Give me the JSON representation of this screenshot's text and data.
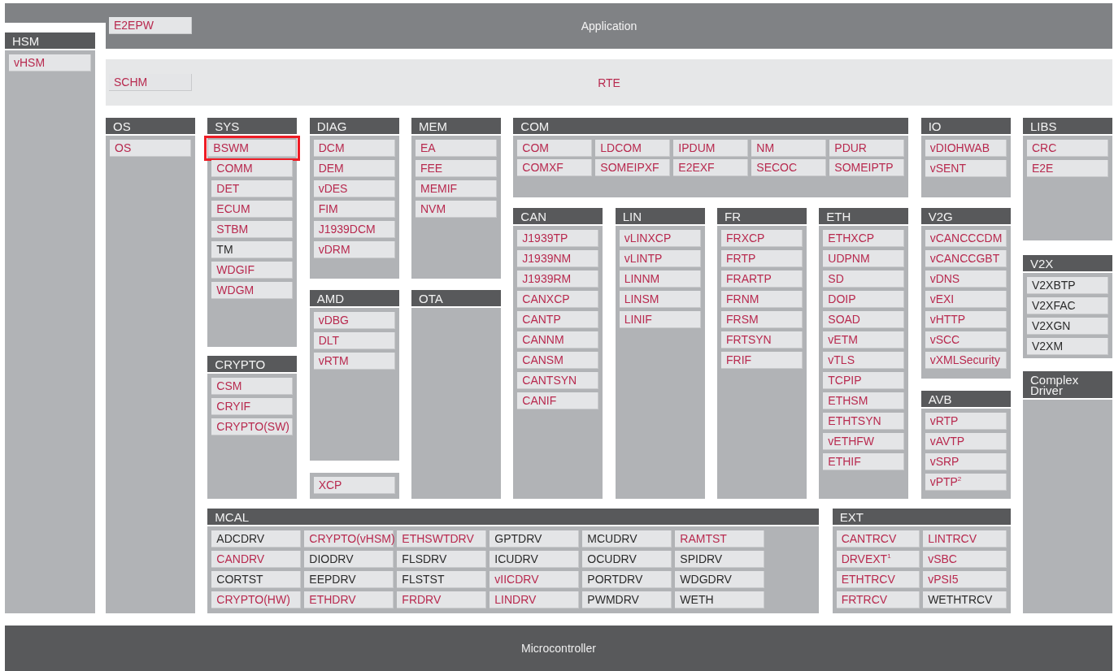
{
  "application": {
    "title": "Application",
    "items": [
      {
        "label": "E2EPW",
        "color": "#b82a4f"
      }
    ]
  },
  "rte": {
    "title": "RTE",
    "items": [
      {
        "label": "SCHM",
        "color": "#b82a4f"
      }
    ]
  },
  "hsm": {
    "title": "HSM",
    "items": [
      {
        "label": "vHSM",
        "color": "#b82a4f"
      }
    ]
  },
  "groups": [
    {
      "title": "OS",
      "items": [
        {
          "label": "OS",
          "color": "#b82a4f"
        }
      ]
    },
    {
      "title": "SYS",
      "items": [
        {
          "label": "BSWM",
          "color": "#b82a4f",
          "highlighted": true
        },
        {
          "label": "COMM",
          "color": "#b82a4f",
          "highlighted": false
        },
        {
          "label": "DET",
          "color": "#b82a4f",
          "highlighted": false
        },
        {
          "label": "ECUM",
          "color": "#b82a4f",
          "highlighted": false
        },
        {
          "label": "STBM",
          "color": "#b82a4f",
          "highlighted": false
        },
        {
          "label": "TM",
          "color": "#2b2b2b",
          "highlighted": false
        },
        {
          "label": "WDGIF",
          "color": "#b82a4f",
          "highlighted": false
        },
        {
          "label": "WDGM",
          "color": "#b82a4f",
          "highlighted": false
        }
      ]
    },
    {
      "title": "CRYPTO",
      "items": [
        {
          "label": "CSM",
          "color": "#b82a4f"
        },
        {
          "label": "CRYIF",
          "color": "#b82a4f"
        },
        {
          "label": "CRYPTO(SW)",
          "color": "#b82a4f"
        }
      ]
    },
    {
      "title": "DIAG",
      "items": [
        {
          "label": "DCM",
          "color": "#b82a4f"
        },
        {
          "label": "DEM",
          "color": "#b82a4f"
        },
        {
          "label": "vDES",
          "color": "#b82a4f"
        },
        {
          "label": "FIM",
          "color": "#b82a4f"
        },
        {
          "label": "J1939DCM",
          "color": "#b82a4f"
        },
        {
          "label": "vDRM",
          "color": "#b82a4f"
        }
      ]
    },
    {
      "title": "AMD",
      "items": [
        {
          "label": "vDBG",
          "color": "#b82a4f"
        },
        {
          "label": "DLT",
          "color": "#b82a4f"
        },
        {
          "label": "vRTM",
          "color": "#b82a4f"
        }
      ]
    },
    {
      "items": [
        {
          "label": "XCP",
          "color": "#b82a4f"
        }
      ]
    },
    {
      "title": "MEM",
      "items": [
        {
          "label": "EA",
          "color": "#b82a4f"
        },
        {
          "label": "FEE",
          "color": "#b82a4f"
        },
        {
          "label": "MEMIF",
          "color": "#b82a4f"
        },
        {
          "label": "NVM",
          "color": "#b82a4f"
        }
      ]
    },
    {
      "title": "OTA"
    },
    {
      "title": "COM",
      "items": [
        {
          "label": "COM",
          "color": "#b82a4f"
        },
        {
          "label": "LDCOM",
          "color": "#b82a4f"
        },
        {
          "label": "IPDUM",
          "color": "#b82a4f"
        },
        {
          "label": "NM",
          "color": "#b82a4f"
        },
        {
          "label": "PDUR",
          "color": "#b82a4f"
        },
        {
          "label": "COMXF",
          "color": "#b82a4f"
        },
        {
          "label": "SOMEIPXF",
          "color": "#b82a4f"
        },
        {
          "label": "E2EXF",
          "color": "#b82a4f"
        },
        {
          "label": "SECOC",
          "color": "#b82a4f"
        },
        {
          "label": "SOMEIPTP",
          "color": "#b82a4f"
        }
      ]
    },
    {
      "title": "CAN",
      "items": [
        {
          "label": "J1939TP",
          "color": "#b82a4f"
        },
        {
          "label": "J1939NM",
          "color": "#b82a4f"
        },
        {
          "label": "J1939RM",
          "color": "#b82a4f"
        },
        {
          "label": "CANXCP",
          "color": "#b82a4f"
        },
        {
          "label": "CANTP",
          "color": "#b82a4f"
        },
        {
          "label": "CANNM",
          "color": "#b82a4f"
        },
        {
          "label": "CANSM",
          "color": "#b82a4f"
        },
        {
          "label": "CANTSYN",
          "color": "#b82a4f"
        },
        {
          "label": "CANIF",
          "color": "#b82a4f"
        }
      ]
    },
    {
      "title": "LIN",
      "items": [
        {
          "label": "vLINXCP",
          "color": "#b82a4f"
        },
        {
          "label": "vLINTP",
          "color": "#b82a4f"
        },
        {
          "label": "LINNM",
          "color": "#b82a4f"
        },
        {
          "label": "LINSM",
          "color": "#b82a4f"
        },
        {
          "label": "LINIF",
          "color": "#b82a4f"
        }
      ]
    },
    {
      "title": "FR",
      "items": [
        {
          "label": "FRXCP",
          "color": "#b82a4f"
        },
        {
          "label": "FRTP",
          "color": "#b82a4f"
        },
        {
          "label": "FRARTP",
          "color": "#b82a4f"
        },
        {
          "label": "FRNM",
          "color": "#b82a4f"
        },
        {
          "label": "FRSM",
          "color": "#b82a4f"
        },
        {
          "label": "FRTSYN",
          "color": "#b82a4f"
        },
        {
          "label": "FRIF",
          "color": "#b82a4f"
        }
      ]
    },
    {
      "title": "ETH",
      "items": [
        {
          "label": "ETHXCP",
          "color": "#b82a4f"
        },
        {
          "label": "UDPNM",
          "color": "#b82a4f"
        },
        {
          "label": "SD",
          "color": "#b82a4f"
        },
        {
          "label": "DOIP",
          "color": "#b82a4f"
        },
        {
          "label": "SOAD",
          "color": "#b82a4f"
        },
        {
          "label": "vETM",
          "color": "#b82a4f"
        },
        {
          "label": "vTLS",
          "color": "#b82a4f"
        },
        {
          "label": "TCPIP",
          "color": "#b82a4f"
        },
        {
          "label": "ETHSM",
          "color": "#b82a4f"
        },
        {
          "label": "ETHTSYN",
          "color": "#b82a4f"
        },
        {
          "label": "vETHFW",
          "color": "#b82a4f"
        },
        {
          "label": "ETHIF",
          "color": "#b82a4f"
        }
      ]
    },
    {
      "title": "IO",
      "items": [
        {
          "label": "vDIOHWAB",
          "color": "#b82a4f"
        },
        {
          "label": "vSENT",
          "color": "#b82a4f"
        }
      ]
    },
    {
      "title": "V2G",
      "items": [
        {
          "label": "vCANCCCDM",
          "color": "#b82a4f"
        },
        {
          "label": "vCANCCGBT",
          "color": "#b82a4f"
        },
        {
          "label": "vDNS",
          "color": "#b82a4f"
        },
        {
          "label": "vEXI",
          "color": "#b82a4f"
        },
        {
          "label": "vHTTP",
          "color": "#b82a4f"
        },
        {
          "label": "vSCC",
          "color": "#b82a4f"
        },
        {
          "label": "vXMLSecurity",
          "color": "#b82a4f"
        }
      ]
    },
    {
      "title": "AVB",
      "items": [
        {
          "label": "vRTP",
          "color": "#b82a4f"
        },
        {
          "label": "vAVTP",
          "color": "#b82a4f"
        },
        {
          "label": "vSRP",
          "color": "#b82a4f"
        },
        {
          "label": "vPTP$^{2}$",
          "color": "#b82a4f"
        }
      ]
    },
    {
      "title": "LIBS",
      "items": [
        {
          "label": "CRC",
          "color": "#b82a4f"
        },
        {
          "label": "E2E",
          "color": "#b82a4f"
        }
      ]
    },
    {
      "title": "V2X",
      "items": [
        {
          "label": "V2XBTP",
          "color": "#2b2b2b"
        },
        {
          "label": "V2XFAC",
          "color": "#2b2b2b"
        },
        {
          "label": "V2XGN",
          "color": "#2b2b2b"
        },
        {
          "label": "V2XM",
          "color": "#2b2b2b"
        }
      ]
    },
    {
      "title": "Complex Driver"
    },
    {
      "title": "MCAL",
      "items": [
        {
          "label": "ADCDRV",
          "color": "#2b2b2b"
        },
        {
          "label": "CRYPTO(vHSM)",
          "color": "#b82a4f"
        },
        {
          "label": "ETHSWTDRV",
          "color": "#b82a4f"
        },
        {
          "label": "GPTDRV",
          "color": "#2b2b2b"
        },
        {
          "label": "MCUDRV",
          "color": "#2b2b2b"
        },
        {
          "label": "RAMTST",
          "color": "#b82a4f"
        },
        {
          "label": "CANDRV",
          "color": "#b82a4f"
        },
        {
          "label": "DIODRV",
          "color": "#2b2b2b"
        },
        {
          "label": "FLSDRV",
          "color": "#2b2b2b"
        },
        {
          "label": "ICUDRV",
          "color": "#2b2b2b"
        },
        {
          "label": "OCUDRV",
          "color": "#2b2b2b"
        },
        {
          "label": "SPIDRV",
          "color": "#2b2b2b"
        },
        {
          "label": "CORTST",
          "color": "#2b2b2b"
        },
        {
          "label": "EEPDRV",
          "color": "#2b2b2b"
        },
        {
          "label": "FLSTST",
          "color": "#2b2b2b"
        },
        {
          "label": "vIICDRV",
          "color": "#b82a4f"
        },
        {
          "label": "PORTDRV",
          "color": "#2b2b2b"
        },
        {
          "label": "WDGDRV",
          "color": "#2b2b2b"
        },
        {
          "label": "CRYPTO(HW)",
          "color": "#b82a4f"
        },
        {
          "label": "ETHDRV",
          "color": "#b82a4f"
        },
        {
          "label": "FRDRV",
          "color": "#b82a4f"
        },
        {
          "label": "LINDRV",
          "color": "#b82a4f"
        },
        {
          "label": "PWMDRV",
          "color": "#2b2b2b"
        },
        {
          "label": "WETH",
          "color": "#2b2b2b"
        }
      ]
    },
    {
      "title": "EXT",
      "items": [
        {
          "label": "CANTRCV",
          "color": "#b82a4f"
        },
        {
          "label": "LINTRCV",
          "color": "#b82a4f"
        },
        {
          "label": "DRVEXT$^{1}$",
          "color": "#b82a4f"
        },
        {
          "label": "vSBC",
          "color": "#b82a4f"
        },
        {
          "label": "ETHTRCV",
          "color": "#b82a4f"
        },
        {
          "label": "vPSI5",
          "color": "#b82a4f"
        },
        {
          "label": "FRTRCV",
          "color": "#b82a4f"
        },
        {
          "label": "WETHTRCV",
          "color": "#2b2b2b"
        }
      ]
    }
  ],
  "microcontroller": {
    "title": "Microcontroller"
  }
}
